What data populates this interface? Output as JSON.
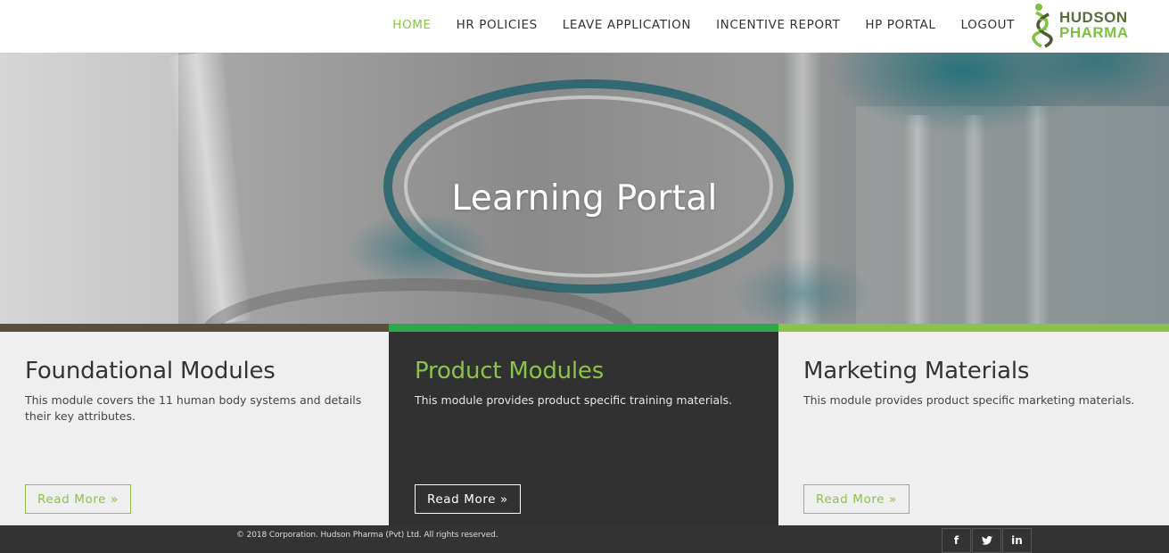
{
  "nav": {
    "items": [
      "HOME",
      "HR POLICIES",
      "LEAVE APPLICATION",
      "INCENTIVE REPORT",
      "HP PORTAL",
      "LOGOUT"
    ],
    "active": "HOME"
  },
  "logo": {
    "line1": "HUDSON",
    "line2": "PHARMA"
  },
  "hero": {
    "title": "Learning Portal"
  },
  "cards": [
    {
      "title": "Foundational Modules",
      "text": "This module covers the 11 human body systems and details their key attributes.",
      "button": "Read More »"
    },
    {
      "title": "Product Modules",
      "text": "This module provides product specific training materials.",
      "button": "Read More »"
    },
    {
      "title": "Marketing Materials",
      "text": "This module provides product specific marketing materials.",
      "button": "Read More »"
    }
  ],
  "footer": {
    "copyright": "© 2018 Corporation. Hudson Pharma (Pvt) Ltd. All rights reserved.",
    "social": [
      {
        "icon": "facebook-icon",
        "glyph": "f"
      },
      {
        "icon": "twitter-icon",
        "glyph": "t"
      },
      {
        "icon": "linkedin-icon",
        "glyph": "in"
      }
    ]
  },
  "colors": {
    "accent_green": "#8bc34a",
    "dark_green_bar": "#2aa84a",
    "brown_bar": "#5a4e3f",
    "dark_card": "#313131",
    "footer": "#333333"
  }
}
